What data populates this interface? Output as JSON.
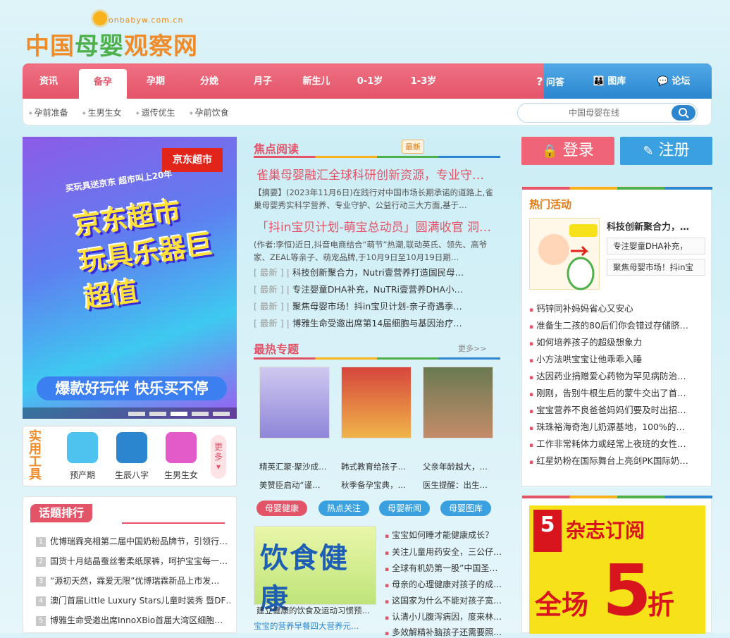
{
  "site": {
    "logo_text_1": "中国",
    "logo_text_2": "母婴",
    "logo_text_3": "观察网",
    "logo_domain": "onbabyw.com.cn"
  },
  "nav": {
    "items": [
      {
        "label": "资讯"
      },
      {
        "label": "备孕"
      },
      {
        "label": "孕期"
      },
      {
        "label": "分娩"
      },
      {
        "label": "月子"
      },
      {
        "label": "新生儿"
      },
      {
        "label": "0-1岁"
      },
      {
        "label": "1-3岁"
      }
    ],
    "right": [
      {
        "label": "问答",
        "icon": "question-icon"
      },
      {
        "label": "图库",
        "icon": "people-icon"
      },
      {
        "label": "论坛",
        "icon": "chat-icon"
      }
    ],
    "active": "备孕"
  },
  "subnav": [
    "孕前准备",
    "生男生女",
    "遗传优生",
    "孕前饮食"
  ],
  "search": {
    "placeholder": "中国母婴在线"
  },
  "banner": {
    "store": "京东超市",
    "big": "京东超市 玩具乐器巨超值",
    "ribbon": "买玩具送京东 超市叫上20年",
    "band": "爆款好玩伴 快乐买不停"
  },
  "tools": {
    "title": "实用工具",
    "items": [
      {
        "label": "预产期",
        "icon": "clock-icon",
        "color": "#4ec3f0"
      },
      {
        "label": "生辰八字",
        "icon": "taiji-icon",
        "color": "#2b86cf"
      },
      {
        "label": "生男生女",
        "icon": "gender-icon",
        "color": "#e35bc8"
      }
    ],
    "more": "更多"
  },
  "rank": {
    "title": "话题排行",
    "items": [
      {
        "n": "1",
        "text": "优博瑞霖亮相第二届中国奶粉品牌节，引领行…"
      },
      {
        "n": "2",
        "text": "国货十月结晶蚕丝奢柔纸尿裤，呵护宝宝每一…"
      },
      {
        "n": "3",
        "text": "“源初天然，霖爱无限”优博瑞霖新品上市发…"
      },
      {
        "n": "4",
        "text": "澳门首届Little Luxury Stars儿童时装秀 暨DF…"
      },
      {
        "n": "5",
        "text": "博雅生命受邀出席InnoXBio首届大湾区细胞…"
      }
    ]
  },
  "focus": {
    "title": "焦点阅读",
    "badge": "最新",
    "h1": "雀巢母婴融汇全球科研创新资源，专业守…",
    "s1": "【摘要】(2023年11月6日)在践行对中国市场长期承诺的道路上,雀巢母婴秀实科学营养、专业守护、公益行动三大方面,基于…",
    "h2": "「抖in宝贝计划-萌宝总动员」圆满收官 洞…",
    "s2": "(作者:李恒)近日,抖音电商结合“萌节”热潮,联动英氏、领先、高爷家、ZEAL等亲子、萌宠品牌,于10月9日至10月19日期…",
    "list": [
      {
        "tag": "[ 最新 ] |",
        "text": "科技创新聚合力，Nutri壹营养打造国民母…"
      },
      {
        "tag": "[ 最新 ] |",
        "text": "专注婴童DHA补充，NuTRi壹营养DHA小…"
      },
      {
        "tag": "[ 最新 ] |",
        "text": "聚焦母婴市场！抖in宝贝计划-亲子奇遇季…"
      },
      {
        "tag": "[ 最新 ] |",
        "text": "博雅生命受邀出席第14届细胞与基因治疗…"
      }
    ]
  },
  "hot_topics": {
    "title": "最热专题",
    "more": "更多>>",
    "captions": [
      "精英汇聚·聚沙成…",
      "韩式教育给孩子…",
      "父亲年龄越大，…",
      "美赞臣启动“谨…",
      "秋季备孕宝典，…",
      "医生提醒：出生…"
    ]
  },
  "tabs": [
    {
      "label": "母婴健康",
      "color": "#e35468"
    },
    {
      "label": "热点关注",
      "color": "#3aa0e0"
    },
    {
      "label": "母婴新闻",
      "color": "#3aa0e0"
    },
    {
      "label": "母婴图库",
      "color": "#3aa0e0"
    }
  ],
  "food": {
    "img_text": "饮食健康",
    "caption": "建立健康的饮食及运动习惯预…",
    "first": "宝宝的营养早餐四大营养元…",
    "list": [
      "宝宝如何睡才能健康成长？",
      "关注儿童用药安全，三公仔…",
      "全球有机奶第一股”中国圣…",
      "母亲的心理健康对孩子的成…",
      "这国家为什么不能对孩子宽…",
      "认清小儿腹泻病因，度来林…",
      "多效解精补脑孩子还需要照…"
    ]
  },
  "auth": {
    "login": "登录",
    "register": "注册"
  },
  "activity": {
    "title": "热门活动",
    "feature": "科技创新聚合力，…",
    "boxes": [
      "专注婴童DHA补充，",
      "聚焦母婴市场！抖in宝"
    ],
    "list": [
      "钙锌同补妈妈省心又安心",
      "准备生二孩的80后们你会错过存储脐…",
      "如何培养孩子的超级想象力",
      "小方法哄宝宝让他乖乖入睡",
      "达因药业捐赠爱心药物为罕见病防治…",
      "刚刚，告别牛根生后的蒙牛交出了首…",
      "宝宝营养不良爸爸妈妈们要及时出招…",
      "珠珠裕海奇泡儿奶源基地，100%的…",
      "工作非常耗体力或经常上夜班的女性…",
      "红星奶粉在国际舞台上亮剑PK国际奶…"
    ]
  },
  "magazine": {
    "t1": "杂志订阅",
    "t2": "全场",
    "big": "5",
    "t3": "折",
    "logo": "5"
  }
}
